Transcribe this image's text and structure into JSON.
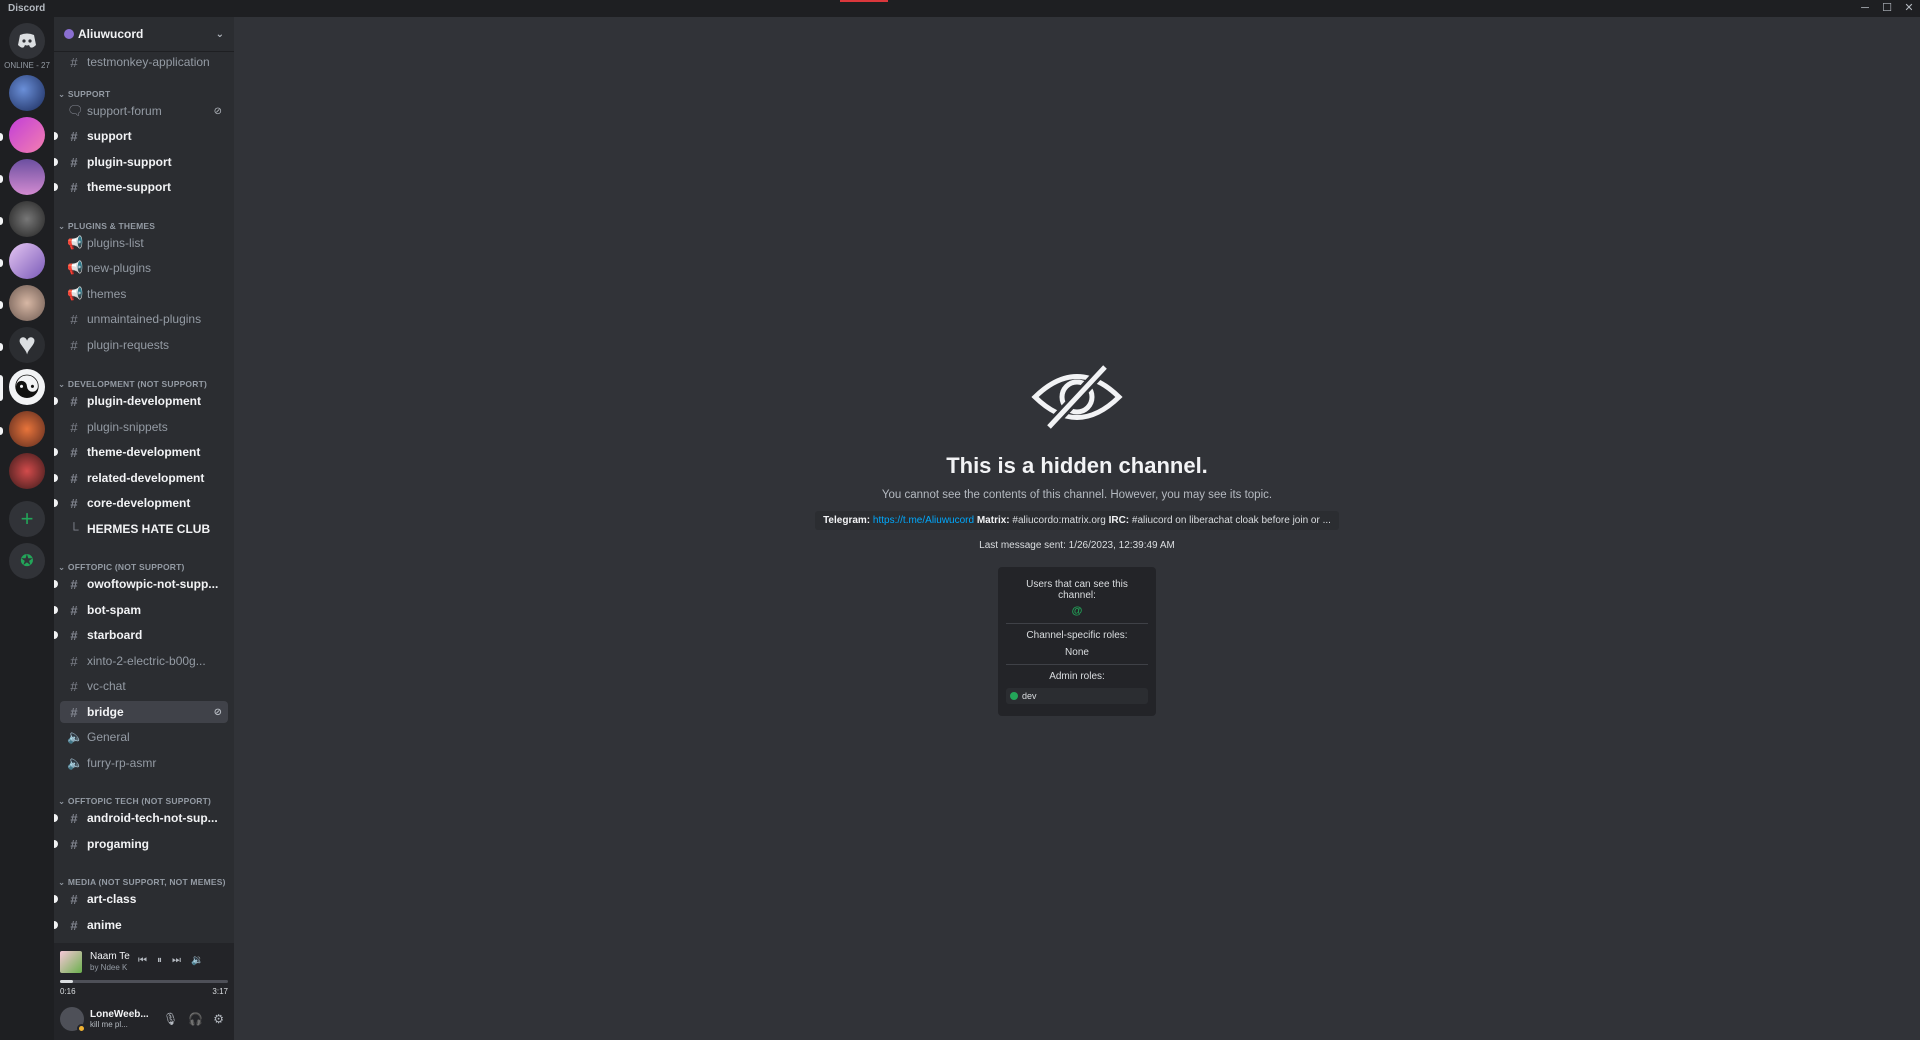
{
  "window": {
    "title": "Discord"
  },
  "rail": {
    "online_label": "ONLINE - 27"
  },
  "guild": {
    "name": "Aliuwucord"
  },
  "channels": {
    "top": {
      "label": "testmonkey-application"
    },
    "cat_support": "SUPPORT",
    "support_forum": "support-forum",
    "support": "support",
    "plugin_support": "plugin-support",
    "theme_support": "theme-support",
    "cat_plugins": "PLUGINS & THEMES",
    "plugins_list": "plugins-list",
    "new_plugins": "new-plugins",
    "themes": "themes",
    "unmaintained": "unmaintained-plugins",
    "plugin_requests": "plugin-requests",
    "cat_dev": "DEVELOPMENT (NOT SUPPORT)",
    "plugin_dev": "plugin-development",
    "plugin_snippets": "plugin-snippets",
    "theme_dev": "theme-development",
    "related_dev": "related-development",
    "core_dev": "core-development",
    "hermes": "HERMES HATE CLUB",
    "cat_offtopic": "OFFTOPIC (NOT SUPPORT)",
    "owoftowpic": "owoftowpic-not-supp...",
    "bot_spam": "bot-spam",
    "starboard": "starboard",
    "xinto": "xinto-2-electric-b00g...",
    "vc_chat": "vc-chat",
    "bridge": "bridge",
    "general": "General",
    "furry": "furry-rp-asmr",
    "cat_tech": "OFFTOPIC TECH (NOT SUPPORT)",
    "android": "android-tech-not-sup...",
    "progaming": "progaming",
    "cat_media": "MEDIA (NOT SUPPORT, NOT MEMES)",
    "art_class": "art-class",
    "anime": "anime"
  },
  "player": {
    "title": "Naam Te",
    "artist": "by Ndee K",
    "elapsed": "0:16",
    "duration": "3:17",
    "progress": 0.08
  },
  "user": {
    "name": "LoneWeeb...",
    "status": "kill me pl..."
  },
  "hidden": {
    "title": "This is a hidden channel.",
    "subtitle": "You cannot see the contents of this channel. However, you may see its topic.",
    "topic_telegram_label": "Telegram:",
    "topic_telegram_link": "https://t.me/Aliuwucord",
    "topic_matrix_label": "Matrix:",
    "topic_matrix_value": "#aliucordo:matrix.org",
    "topic_irc_label": "IRC:",
    "topic_irc_value": "#aliucord on liberachat cloak before join or ...",
    "last_message": "Last message sent: 1/26/2023, 12:39:49 AM",
    "users_label": "Users that can see this channel:",
    "users_value": "@",
    "channel_roles_label": "Channel-specific roles:",
    "channel_roles_value": "None",
    "admin_roles_label": "Admin roles:",
    "admin_role": "dev"
  },
  "colors": {
    "accent_green": "#23a559",
    "link": "#00a8fc",
    "bg_main": "#313338",
    "bg_sidebar": "#2b2d31",
    "bg_rail": "#1e1f22"
  }
}
